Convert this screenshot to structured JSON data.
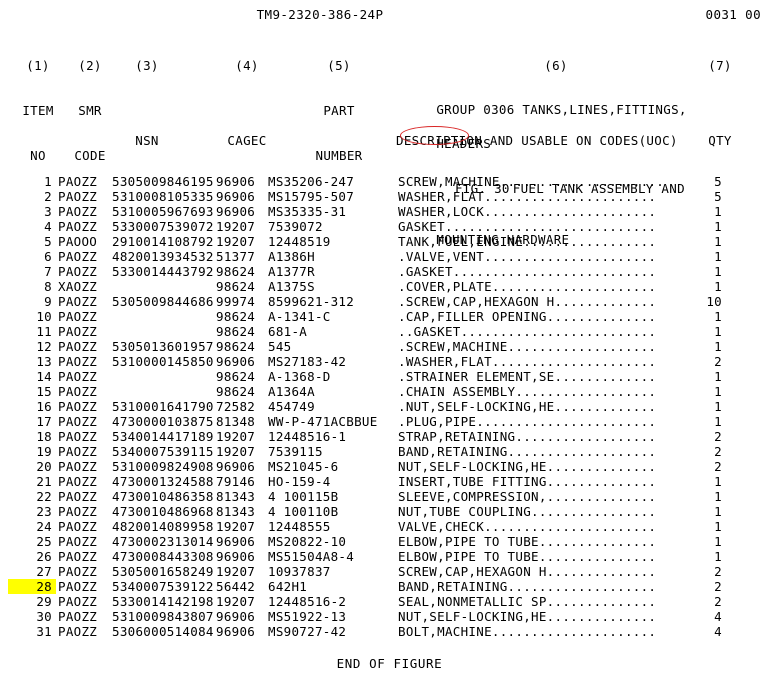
{
  "document": {
    "tm_number": "TM9-2320-386-24P",
    "page_number": "0031 00",
    "end_marker": "END OF FIGURE"
  },
  "column_headers": [
    {
      "number": "(1)",
      "line1": "ITEM",
      "line2": "NO"
    },
    {
      "number": "(2)",
      "line1": "SMR",
      "line2": "CODE"
    },
    {
      "number": "(3)",
      "line1": "",
      "line2": "NSN"
    },
    {
      "number": "(4)",
      "line1": "",
      "line2": "CAGEC"
    },
    {
      "number": "(5)",
      "line1": "PART",
      "line2": "NUMBER"
    },
    {
      "number": "(6)",
      "line1": "",
      "line2": "DESCRIPTION AND USABLE ON CODES(UOC)"
    },
    {
      "number": "(7)",
      "line1": "",
      "line2": "QTY"
    }
  ],
  "group_heading": {
    "line1": "GROUP 0306 TANKS,LINES,FITTINGS,",
    "line2": "HEADERS"
  },
  "figure_heading": {
    "fig_ref": "FIG. 30",
    "title_line1": "FUEL TANK ASSEMBLY AND",
    "title_line2": "MOUNTING HARDWARE",
    "circle_color": "#d92626"
  },
  "highlight": {
    "item_no": "28",
    "color": "#ffff00"
  },
  "rows": [
    {
      "item": "1",
      "smr": "PAOZZ",
      "nsn": "5305009846195",
      "cagec": "96906",
      "part": "MS35206-247",
      "desc": "SCREW,MACHINE.....................",
      "qty": "5"
    },
    {
      "item": "2",
      "smr": "PAOZZ",
      "nsn": "5310008105335",
      "cagec": "96906",
      "part": "MS15795-507",
      "desc": "WASHER,FLAT......................",
      "qty": "5"
    },
    {
      "item": "3",
      "smr": "PAOZZ",
      "nsn": "5310005967693",
      "cagec": "96906",
      "part": "MS35335-31",
      "desc": "WASHER,LOCK......................",
      "qty": "1"
    },
    {
      "item": "4",
      "smr": "PAOZZ",
      "nsn": "5330007539072",
      "cagec": "19207",
      "part": "7539072",
      "desc": "GASKET...........................",
      "qty": "1"
    },
    {
      "item": "5",
      "smr": "PAOOO",
      "nsn": "2910014108792",
      "cagec": "19207",
      "part": "12448519",
      "desc": "TANK,FUEL,ENGINE.................",
      "qty": "1"
    },
    {
      "item": "6",
      "smr": "PAOZZ",
      "nsn": "4820013934532",
      "cagec": "51377",
      "part": "A1386H",
      "desc": ".VALVE,VENT......................",
      "qty": "1"
    },
    {
      "item": "7",
      "smr": "PAOZZ",
      "nsn": "5330014443792",
      "cagec": "98624",
      "part": "A1377R",
      "desc": ".GASKET..........................",
      "qty": "1"
    },
    {
      "item": "8",
      "smr": "XAOZZ",
      "nsn": "",
      "cagec": "98624",
      "part": "A1375S",
      "desc": ".COVER,PLATE.....................",
      "qty": "1"
    },
    {
      "item": "9",
      "smr": "PAOZZ",
      "nsn": "5305009844686",
      "cagec": "99974",
      "part": "8599621-312",
      "desc": ".SCREW,CAP,HEXAGON H.............",
      "qty": "10"
    },
    {
      "item": "10",
      "smr": "PAOZZ",
      "nsn": "",
      "cagec": "98624",
      "part": "A-1341-C",
      "desc": ".CAP,FILLER OPENING..............",
      "qty": "1"
    },
    {
      "item": "11",
      "smr": "PAOZZ",
      "nsn": "",
      "cagec": "98624",
      "part": "681-A",
      "desc": "..GASKET.........................",
      "qty": "1"
    },
    {
      "item": "12",
      "smr": "PAOZZ",
      "nsn": "5305013601957",
      "cagec": "98624",
      "part": "545",
      "desc": ".SCREW,MACHINE...................",
      "qty": "1"
    },
    {
      "item": "13",
      "smr": "PAOZZ",
      "nsn": "5310000145850",
      "cagec": "96906",
      "part": "MS27183-42",
      "desc": ".WASHER,FLAT.....................",
      "qty": "2"
    },
    {
      "item": "14",
      "smr": "PAOZZ",
      "nsn": "",
      "cagec": "98624",
      "part": "A-1368-D",
      "desc": ".STRAINER ELEMENT,SE.............",
      "qty": "1"
    },
    {
      "item": "15",
      "smr": "PAOZZ",
      "nsn": "",
      "cagec": "98624",
      "part": "A1364A",
      "desc": ".CHAIN ASSEMBLY..................",
      "qty": "1"
    },
    {
      "item": "16",
      "smr": "PAOZZ",
      "nsn": "5310001641790",
      "cagec": "72582",
      "part": "454749",
      "desc": ".NUT,SELF-LOCKING,HE.............",
      "qty": "1"
    },
    {
      "item": "17",
      "smr": "PAOZZ",
      "nsn": "4730000103875",
      "cagec": "81348",
      "part": "WW-P-471ACBBUE",
      "desc": ".PLUG,PIPE.......................",
      "qty": "1"
    },
    {
      "item": "18",
      "smr": "PAOZZ",
      "nsn": "5340014417189",
      "cagec": "19207",
      "part": "12448516-1",
      "desc": "STRAP,RETAINING..................",
      "qty": "2"
    },
    {
      "item": "19",
      "smr": "PAOZZ",
      "nsn": "5340007539115",
      "cagec": "19207",
      "part": "7539115",
      "desc": "BAND,RETAINING...................",
      "qty": "2"
    },
    {
      "item": "20",
      "smr": "PAOZZ",
      "nsn": "5310009824908",
      "cagec": "96906",
      "part": "MS21045-6",
      "desc": "NUT,SELF-LOCKING,HE..............",
      "qty": "2"
    },
    {
      "item": "21",
      "smr": "PAOZZ",
      "nsn": "4730001324588",
      "cagec": "79146",
      "part": "HO-159-4",
      "desc": "INSERT,TUBE FITTING..............",
      "qty": "1"
    },
    {
      "item": "22",
      "smr": "PAOZZ",
      "nsn": "4730010486358",
      "cagec": "81343",
      "part": "4 100115B",
      "desc": "SLEEVE,COMPRESSION,..............",
      "qty": "1"
    },
    {
      "item": "23",
      "smr": "PAOZZ",
      "nsn": "4730010486968",
      "cagec": "81343",
      "part": "4 100110B",
      "desc": "NUT,TUBE COUPLING................",
      "qty": "1"
    },
    {
      "item": "24",
      "smr": "PAOZZ",
      "nsn": "4820014089958",
      "cagec": "19207",
      "part": "12448555",
      "desc": "VALVE,CHECK......................",
      "qty": "1"
    },
    {
      "item": "25",
      "smr": "PAOZZ",
      "nsn": "4730002313014",
      "cagec": "96906",
      "part": "MS20822-10",
      "desc": "ELBOW,PIPE TO TUBE...............",
      "qty": "1"
    },
    {
      "item": "26",
      "smr": "PAOZZ",
      "nsn": "4730008443308",
      "cagec": "96906",
      "part": "MS51504A8-4",
      "desc": "ELBOW,PIPE TO TUBE...............",
      "qty": "1"
    },
    {
      "item": "27",
      "smr": "PAOZZ",
      "nsn": "5305001658249",
      "cagec": "19207",
      "part": "10937837",
      "desc": "SCREW,CAP,HEXAGON H..............",
      "qty": "2"
    },
    {
      "item": "28",
      "smr": "PAOZZ",
      "nsn": "5340007539122",
      "cagec": "56442",
      "part": "642H1",
      "desc": "BAND,RETAINING...................",
      "qty": "2"
    },
    {
      "item": "29",
      "smr": "PAOZZ",
      "nsn": "5330014142198",
      "cagec": "19207",
      "part": "12448516-2",
      "desc": "SEAL,NONMETALLIC SP..............",
      "qty": "2"
    },
    {
      "item": "30",
      "smr": "PAOZZ",
      "nsn": "5310009843807",
      "cagec": "96906",
      "part": "MS51922-13",
      "desc": "NUT,SELF-LOCKING,HE..............",
      "qty": "4"
    },
    {
      "item": "31",
      "smr": "PAOZZ",
      "nsn": "5306000514084",
      "cagec": "96906",
      "part": "MS90727-42",
      "desc": "BOLT,MACHINE.....................",
      "qty": "4"
    }
  ]
}
